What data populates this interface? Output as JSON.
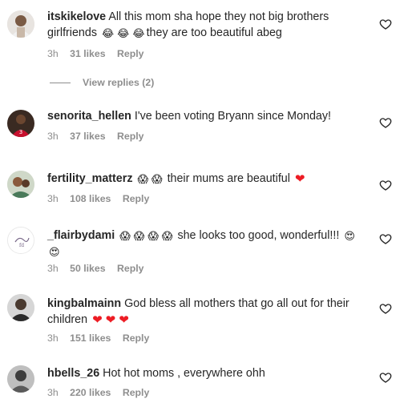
{
  "colors": {
    "heart": "#ed1c24",
    "meta": "#8e8e8e",
    "text": "#262626"
  },
  "comments": [
    {
      "username": "itskikelove",
      "text_parts": [
        "All this mom sha hope they not big brothers girlfriends",
        "they are too beautiful abeg"
      ],
      "emojis": [
        "😂",
        "😂",
        "😂"
      ],
      "time": "3h",
      "likes": "31 likes",
      "reply": "Reply",
      "view_replies": "View replies (2)"
    },
    {
      "username": "senorita_hellen",
      "text": "I've been voting Bryann since Monday!",
      "time": "3h",
      "likes": "37 likes",
      "reply": "Reply"
    },
    {
      "username": "fertility_matterz",
      "text_before_emojis": "",
      "emojis": [
        "😱",
        "😱"
      ],
      "text": "their mums are beautiful",
      "end_emoji": "❤",
      "time": "3h",
      "likes": "108 likes",
      "reply": "Reply"
    },
    {
      "username": "_flairbydami",
      "emojis": [
        "😱",
        "😱",
        "😱",
        "😱"
      ],
      "text": "she looks too good, wonderful!!!",
      "end_emojis": [
        "😍",
        "😍"
      ],
      "time": "3h",
      "likes": "50 likes",
      "reply": "Reply"
    },
    {
      "username": "kingbalmainn",
      "text": "God bless all mothers that go all out for their children",
      "end_emojis": [
        "❤",
        "❤",
        "❤"
      ],
      "time": "3h",
      "likes": "151 likes",
      "reply": "Reply"
    },
    {
      "username": "hbells_26",
      "text": "Hot hot moms , everywhere ohh",
      "time": "3h",
      "likes": "220 likes",
      "reply": "Reply"
    }
  ]
}
